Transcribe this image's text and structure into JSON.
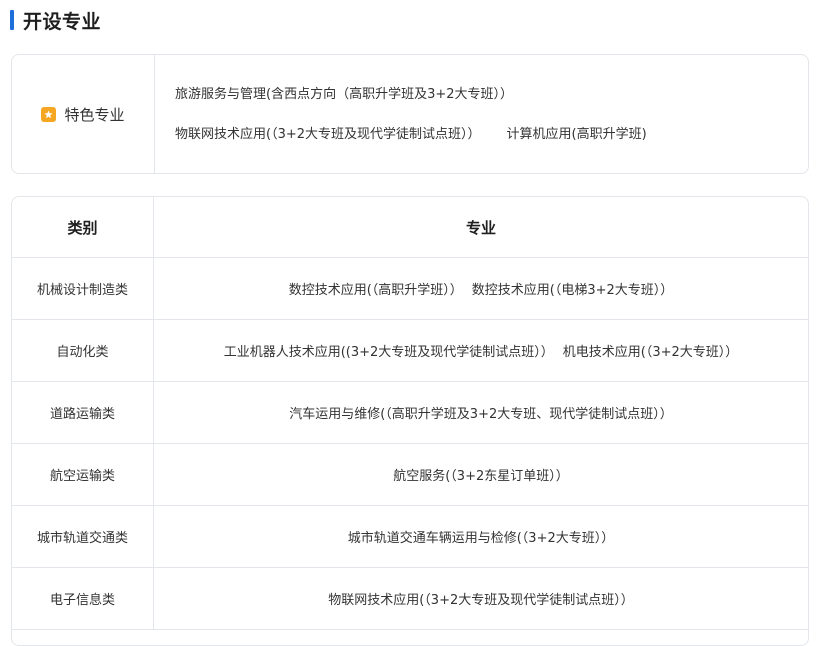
{
  "section": {
    "title": "开设专业",
    "accent_color": "#1e6fd9"
  },
  "featured": {
    "label": "特色专业",
    "badge_icon": "star-badge-icon",
    "badge_color": "#f5a623",
    "line1": "旅游服务与管理(含西点方向（高职升学班及3+2大专班））",
    "line2_a": "物联网技术应用(（3+2大专班及现代学徒制试点班））",
    "line2_b": "计算机应用(高职升学班)"
  },
  "table": {
    "headers": {
      "category": "类别",
      "major": "专业"
    },
    "rows": [
      {
        "category": "机械设计制造类",
        "majors": [
          "数控技术应用(（高职升学班））",
          "数控技术应用(（电梯3+2大专班））"
        ]
      },
      {
        "category": "自动化类",
        "majors": [
          "工业机器人技术应用((3+2大专班及现代学徒制试点班））",
          "机电技术应用(（3+2大专班））"
        ]
      },
      {
        "category": "道路运输类",
        "majors": [
          "汽车运用与维修(（高职升学班及3+2大专班、现代学徒制试点班））"
        ]
      },
      {
        "category": "航空运输类",
        "majors": [
          "航空服务(（3+2东星订单班））"
        ]
      },
      {
        "category": "城市轨道交通类",
        "majors": [
          "城市轨道交通车辆运用与检修(（3+2大专班））"
        ]
      },
      {
        "category": "电子信息类",
        "majors": [
          "物联网技术应用(（3+2大专班及现代学徒制试点班））"
        ]
      }
    ]
  }
}
